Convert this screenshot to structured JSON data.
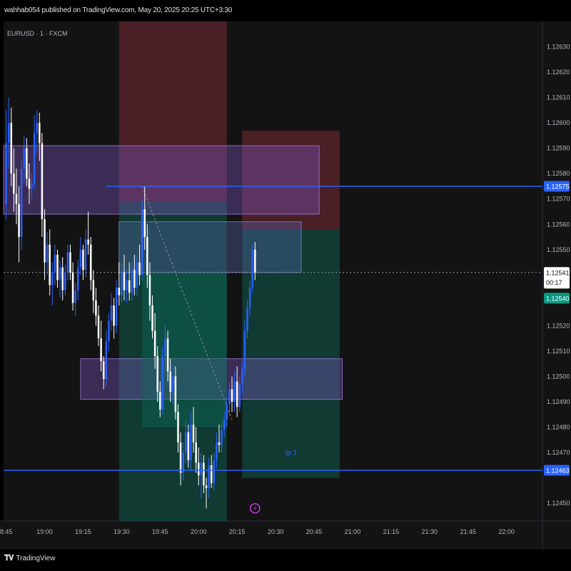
{
  "header": {
    "published_text": "wahhab054 published on TradingView.com, May 20, 2025 20:25 UTC+3:30"
  },
  "footer": {
    "brand": "TradingView",
    "brand_icon": "tradingview-logo-icon"
  },
  "colors": {
    "background": "#131313",
    "up_candle": "#2962ff",
    "down_candle": "#ffffff",
    "level_line": "#2962ff",
    "price_tag_green": "#089981",
    "zone_red": "#b2364a",
    "zone_green": "#0e6b58",
    "fvg_purple": "#7e57c2",
    "box_blue": "#5b6ab8",
    "lightning": "#e040fb"
  },
  "chart_data": {
    "type": "candlestick",
    "symbol_label": "EURUSD · 1 · FXCM",
    "x_tick_labels": [
      "8:45",
      "19:00",
      "19:15",
      "19:30",
      "19:45",
      "20:00",
      "20:15",
      "20:30",
      "20:45",
      "21:00",
      "21:15",
      "21:30",
      "21:45",
      "22:00"
    ],
    "x_tick_times": [
      "18:45",
      "19:00",
      "19:15",
      "19:30",
      "19:45",
      "20:00",
      "20:15",
      "20:30",
      "20:45",
      "21:00",
      "21:15",
      "21:30",
      "21:45",
      "22:00"
    ],
    "x_range": [
      "18:44",
      "22:14"
    ],
    "y_tick_labels": [
      "1.12630",
      "1.12620",
      "1.12610",
      "1.12600",
      "1.12590",
      "1.12580",
      "1.12570",
      "1.12560",
      "1.12550",
      "1.12520",
      "1.12510",
      "1.12500",
      "1.12490",
      "1.12480",
      "1.12470",
      "1.12450"
    ],
    "ylim": [
      1.12443,
      1.1264
    ],
    "candles": [
      {
        "t": "18:45",
        "o": 1.12568,
        "h": 1.12605,
        "l": 1.12562,
        "c": 1.12592
      },
      {
        "t": "18:46",
        "o": 1.12592,
        "h": 1.1261,
        "l": 1.12582,
        "c": 1.126
      },
      {
        "t": "18:47",
        "o": 1.126,
        "h": 1.12606,
        "l": 1.12575,
        "c": 1.1258
      },
      {
        "t": "18:48",
        "o": 1.1258,
        "h": 1.1259,
        "l": 1.12565,
        "c": 1.12572
      },
      {
        "t": "18:49",
        "o": 1.12572,
        "h": 1.12582,
        "l": 1.1256,
        "c": 1.12568
      },
      {
        "t": "18:50",
        "o": 1.12568,
        "h": 1.12575,
        "l": 1.12545,
        "c": 1.12555
      },
      {
        "t": "18:51",
        "o": 1.12555,
        "h": 1.12585,
        "l": 1.1255,
        "c": 1.12582
      },
      {
        "t": "18:52",
        "o": 1.12582,
        "h": 1.12595,
        "l": 1.12576,
        "c": 1.1259
      },
      {
        "t": "18:53",
        "o": 1.1259,
        "h": 1.12594,
        "l": 1.12575,
        "c": 1.12578
      },
      {
        "t": "18:54",
        "o": 1.12578,
        "h": 1.12584,
        "l": 1.12568,
        "c": 1.12574
      },
      {
        "t": "18:55",
        "o": 1.12574,
        "h": 1.1258,
        "l": 1.1257,
        "c": 1.12576
      },
      {
        "t": "18:56",
        "o": 1.12576,
        "h": 1.12603,
        "l": 1.12574,
        "c": 1.12596
      },
      {
        "t": "18:57",
        "o": 1.12596,
        "h": 1.12605,
        "l": 1.12588,
        "c": 1.126
      },
      {
        "t": "18:58",
        "o": 1.126,
        "h": 1.12604,
        "l": 1.12585,
        "c": 1.12592
      },
      {
        "t": "18:59",
        "o": 1.12592,
        "h": 1.12596,
        "l": 1.12555,
        "c": 1.12562
      },
      {
        "t": "19:00",
        "o": 1.12562,
        "h": 1.12566,
        "l": 1.12538,
        "c": 1.12545
      },
      {
        "t": "19:01",
        "o": 1.12545,
        "h": 1.12557,
        "l": 1.1254,
        "c": 1.12552
      },
      {
        "t": "19:02",
        "o": 1.12552,
        "h": 1.12558,
        "l": 1.12532,
        "c": 1.12536
      },
      {
        "t": "19:03",
        "o": 1.12536,
        "h": 1.12545,
        "l": 1.12528,
        "c": 1.12541
      },
      {
        "t": "19:04",
        "o": 1.12541,
        "h": 1.12552,
        "l": 1.12536,
        "c": 1.12548
      },
      {
        "t": "19:05",
        "o": 1.12548,
        "h": 1.1255,
        "l": 1.12535,
        "c": 1.12538
      },
      {
        "t": "19:06",
        "o": 1.12538,
        "h": 1.12546,
        "l": 1.12531,
        "c": 1.12543
      },
      {
        "t": "19:07",
        "o": 1.12543,
        "h": 1.12547,
        "l": 1.1253,
        "c": 1.12534
      },
      {
        "t": "19:08",
        "o": 1.12534,
        "h": 1.12544,
        "l": 1.12532,
        "c": 1.12541
      },
      {
        "t": "19:09",
        "o": 1.12541,
        "h": 1.12552,
        "l": 1.12538,
        "c": 1.12549
      },
      {
        "t": "19:10",
        "o": 1.12549,
        "h": 1.12552,
        "l": 1.12538,
        "c": 1.12541
      },
      {
        "t": "19:11",
        "o": 1.12541,
        "h": 1.12545,
        "l": 1.12526,
        "c": 1.12529
      },
      {
        "t": "19:12",
        "o": 1.12529,
        "h": 1.12537,
        "l": 1.12524,
        "c": 1.12534
      },
      {
        "t": "19:13",
        "o": 1.12534,
        "h": 1.12546,
        "l": 1.1253,
        "c": 1.12543
      },
      {
        "t": "19:14",
        "o": 1.12543,
        "h": 1.12555,
        "l": 1.1254,
        "c": 1.1255
      },
      {
        "t": "19:15",
        "o": 1.1255,
        "h": 1.12552,
        "l": 1.12538,
        "c": 1.12542
      },
      {
        "t": "19:16",
        "o": 1.12542,
        "h": 1.12558,
        "l": 1.12539,
        "c": 1.12554
      },
      {
        "t": "19:17",
        "o": 1.12554,
        "h": 1.12565,
        "l": 1.12548,
        "c": 1.12552
      },
      {
        "t": "19:18",
        "o": 1.12552,
        "h": 1.12555,
        "l": 1.12534,
        "c": 1.12538
      },
      {
        "t": "19:19",
        "o": 1.12538,
        "h": 1.12542,
        "l": 1.12525,
        "c": 1.1253
      },
      {
        "t": "19:20",
        "o": 1.1253,
        "h": 1.12535,
        "l": 1.1252,
        "c": 1.12524
      },
      {
        "t": "19:21",
        "o": 1.12524,
        "h": 1.12528,
        "l": 1.12512,
        "c": 1.12515
      },
      {
        "t": "19:22",
        "o": 1.12515,
        "h": 1.12522,
        "l": 1.12502,
        "c": 1.12506
      },
      {
        "t": "19:23",
        "o": 1.12506,
        "h": 1.12508,
        "l": 1.12495,
        "c": 1.12499
      },
      {
        "t": "19:24",
        "o": 1.12499,
        "h": 1.12518,
        "l": 1.12496,
        "c": 1.12514
      },
      {
        "t": "19:25",
        "o": 1.12514,
        "h": 1.12525,
        "l": 1.1251,
        "c": 1.12522
      },
      {
        "t": "19:26",
        "o": 1.12522,
        "h": 1.12533,
        "l": 1.12518,
        "c": 1.12528
      },
      {
        "t": "19:27",
        "o": 1.12528,
        "h": 1.12531,
        "l": 1.12515,
        "c": 1.1252
      },
      {
        "t": "19:28",
        "o": 1.1252,
        "h": 1.12538,
        "l": 1.12517,
        "c": 1.12535
      },
      {
        "t": "19:29",
        "o": 1.12535,
        "h": 1.12545,
        "l": 1.12528,
        "c": 1.12532
      },
      {
        "t": "19:30",
        "o": 1.12532,
        "h": 1.12545,
        "l": 1.12529,
        "c": 1.12541
      },
      {
        "t": "19:31",
        "o": 1.12541,
        "h": 1.12548,
        "l": 1.1253,
        "c": 1.12534
      },
      {
        "t": "19:32",
        "o": 1.12534,
        "h": 1.12542,
        "l": 1.12529,
        "c": 1.12538
      },
      {
        "t": "19:33",
        "o": 1.12538,
        "h": 1.12545,
        "l": 1.1253,
        "c": 1.12533
      },
      {
        "t": "19:34",
        "o": 1.12533,
        "h": 1.12545,
        "l": 1.1253,
        "c": 1.12542
      },
      {
        "t": "19:35",
        "o": 1.12542,
        "h": 1.12548,
        "l": 1.12532,
        "c": 1.12535
      },
      {
        "t": "19:36",
        "o": 1.12535,
        "h": 1.12548,
        "l": 1.12532,
        "c": 1.12545
      },
      {
        "t": "19:37",
        "o": 1.12545,
        "h": 1.12552,
        "l": 1.12536,
        "c": 1.1254
      },
      {
        "t": "19:38",
        "o": 1.1254,
        "h": 1.1257,
        "l": 1.12538,
        "c": 1.12566
      },
      {
        "t": "19:39",
        "o": 1.12566,
        "h": 1.12575,
        "l": 1.1255,
        "c": 1.12555
      },
      {
        "t": "19:40",
        "o": 1.12555,
        "h": 1.1256,
        "l": 1.12535,
        "c": 1.1254
      },
      {
        "t": "19:41",
        "o": 1.1254,
        "h": 1.12545,
        "l": 1.12522,
        "c": 1.12528
      },
      {
        "t": "19:42",
        "o": 1.12528,
        "h": 1.12532,
        "l": 1.12515,
        "c": 1.12518
      },
      {
        "t": "19:43",
        "o": 1.12518,
        "h": 1.12525,
        "l": 1.12503,
        "c": 1.12508
      },
      {
        "t": "19:44",
        "o": 1.12508,
        "h": 1.12512,
        "l": 1.1249,
        "c": 1.12494
      },
      {
        "t": "19:45",
        "o": 1.12494,
        "h": 1.12498,
        "l": 1.12484,
        "c": 1.12487
      },
      {
        "t": "19:46",
        "o": 1.12487,
        "h": 1.12512,
        "l": 1.12485,
        "c": 1.12508
      },
      {
        "t": "19:47",
        "o": 1.12508,
        "h": 1.1252,
        "l": 1.12502,
        "c": 1.12515
      },
      {
        "t": "19:48",
        "o": 1.12515,
        "h": 1.12518,
        "l": 1.12498,
        "c": 1.12502
      },
      {
        "t": "19:49",
        "o": 1.12502,
        "h": 1.12507,
        "l": 1.1249,
        "c": 1.12494
      },
      {
        "t": "19:50",
        "o": 1.12494,
        "h": 1.12505,
        "l": 1.12489,
        "c": 1.125
      },
      {
        "t": "19:51",
        "o": 1.125,
        "h": 1.12504,
        "l": 1.12483,
        "c": 1.12486
      },
      {
        "t": "19:52",
        "o": 1.12486,
        "h": 1.12489,
        "l": 1.1247,
        "c": 1.12474
      },
      {
        "t": "19:53",
        "o": 1.12474,
        "h": 1.12478,
        "l": 1.12457,
        "c": 1.12462
      },
      {
        "t": "19:54",
        "o": 1.12462,
        "h": 1.12474,
        "l": 1.12459,
        "c": 1.1247
      },
      {
        "t": "19:55",
        "o": 1.1247,
        "h": 1.12482,
        "l": 1.12466,
        "c": 1.12478
      },
      {
        "t": "19:56",
        "o": 1.12478,
        "h": 1.12481,
        "l": 1.12464,
        "c": 1.12467
      },
      {
        "t": "19:57",
        "o": 1.12467,
        "h": 1.12486,
        "l": 1.12463,
        "c": 1.12481
      },
      {
        "t": "19:58",
        "o": 1.12481,
        "h": 1.12488,
        "l": 1.1247,
        "c": 1.12474
      },
      {
        "t": "19:59",
        "o": 1.12474,
        "h": 1.1248,
        "l": 1.12462,
        "c": 1.12466
      },
      {
        "t": "20:00",
        "o": 1.12466,
        "h": 1.12472,
        "l": 1.12457,
        "c": 1.12461
      },
      {
        "t": "20:01",
        "o": 1.12461,
        "h": 1.1247,
        "l": 1.12452,
        "c": 1.12466
      },
      {
        "t": "20:02",
        "o": 1.12466,
        "h": 1.12469,
        "l": 1.12454,
        "c": 1.12457
      },
      {
        "t": "20:03",
        "o": 1.12457,
        "h": 1.1246,
        "l": 1.12448,
        "c": 1.12456
      },
      {
        "t": "20:04",
        "o": 1.12456,
        "h": 1.12468,
        "l": 1.12452,
        "c": 1.12465
      },
      {
        "t": "20:05",
        "o": 1.12465,
        "h": 1.12469,
        "l": 1.12456,
        "c": 1.12458
      },
      {
        "t": "20:06",
        "o": 1.12458,
        "h": 1.1247,
        "l": 1.12455,
        "c": 1.12467
      },
      {
        "t": "20:07",
        "o": 1.12467,
        "h": 1.12478,
        "l": 1.12464,
        "c": 1.12474
      },
      {
        "t": "20:08",
        "o": 1.12474,
        "h": 1.12481,
        "l": 1.1247,
        "c": 1.12473
      },
      {
        "t": "20:09",
        "o": 1.12473,
        "h": 1.12482,
        "l": 1.1247,
        "c": 1.12479
      },
      {
        "t": "20:10",
        "o": 1.12479,
        "h": 1.12486,
        "l": 1.12476,
        "c": 1.12483
      },
      {
        "t": "20:11",
        "o": 1.12483,
        "h": 1.12492,
        "l": 1.1248,
        "c": 1.12489
      },
      {
        "t": "20:12",
        "o": 1.12489,
        "h": 1.12498,
        "l": 1.12485,
        "c": 1.12495
      },
      {
        "t": "20:13",
        "o": 1.12495,
        "h": 1.125,
        "l": 1.12486,
        "c": 1.1249
      },
      {
        "t": "20:14",
        "o": 1.1249,
        "h": 1.12502,
        "l": 1.12486,
        "c": 1.12498
      },
      {
        "t": "20:15",
        "o": 1.12498,
        "h": 1.12504,
        "l": 1.12484,
        "c": 1.12488
      },
      {
        "t": "20:16",
        "o": 1.12488,
        "h": 1.125,
        "l": 1.12486,
        "c": 1.12497
      },
      {
        "t": "20:17",
        "o": 1.12497,
        "h": 1.12506,
        "l": 1.12493,
        "c": 1.12503
      },
      {
        "t": "20:18",
        "o": 1.12503,
        "h": 1.12522,
        "l": 1.125,
        "c": 1.12518
      },
      {
        "t": "20:19",
        "o": 1.12518,
        "h": 1.1253,
        "l": 1.12515,
        "c": 1.12527
      },
      {
        "t": "20:20",
        "o": 1.12527,
        "h": 1.12538,
        "l": 1.12524,
        "c": 1.12535
      },
      {
        "t": "20:21",
        "o": 1.12535,
        "h": 1.12552,
        "l": 1.12533,
        "c": 1.1255
      },
      {
        "t": "20:22",
        "o": 1.1255,
        "h": 1.12553,
        "l": 1.12538,
        "c": 1.12541
      }
    ],
    "horizontal_levels": [
      {
        "price": 1.12575,
        "label": "1.12575",
        "from": "19:24"
      },
      {
        "price": 1.12463,
        "label": "1.12463",
        "from": "18:44"
      }
    ],
    "last_price": {
      "price": 1.12541,
      "label": "1.12541",
      "countdown": "00:17"
    },
    "price_tag_green": {
      "price": 1.1254,
      "label": "1.12540"
    },
    "zones": [
      {
        "kind": "red",
        "t1": "19:29",
        "t2": "20:11",
        "p1": 1.1264,
        "p2": 1.12569
      },
      {
        "kind": "green",
        "t1": "19:29",
        "t2": "20:11",
        "p1": 1.12569,
        "p2": 1.12443
      },
      {
        "kind": "red",
        "t1": "20:17",
        "t2": "20:55",
        "p1": 1.12597,
        "p2": 1.12558
      },
      {
        "kind": "green",
        "t1": "20:17",
        "t2": "20:55",
        "p1": 1.12558,
        "p2": 1.1246
      },
      {
        "kind": "purple",
        "t1": "18:44",
        "t2": "20:47",
        "p1": 1.12591,
        "p2": 1.12564
      },
      {
        "kind": "purple",
        "t1": "19:14",
        "t2": "20:56",
        "p1": 1.12507,
        "p2": 1.12491
      },
      {
        "kind": "blue",
        "t1": "19:29",
        "t2": "20:40",
        "p1": 1.12561,
        "p2": 1.12541
      },
      {
        "kind": "green",
        "t1": "19:38",
        "t2": "20:11",
        "p1": 1.12541,
        "p2": 1.1248
      }
    ],
    "trend_line": {
      "t1": "19:38",
      "p1": 1.12575,
      "t2": "20:13",
      "p2": 1.12483
    },
    "annotation": {
      "text": "tp 1",
      "t": "20:36",
      "p": 1.12469
    },
    "lightning_marker": {
      "t": "20:22",
      "p": 1.12448
    }
  }
}
